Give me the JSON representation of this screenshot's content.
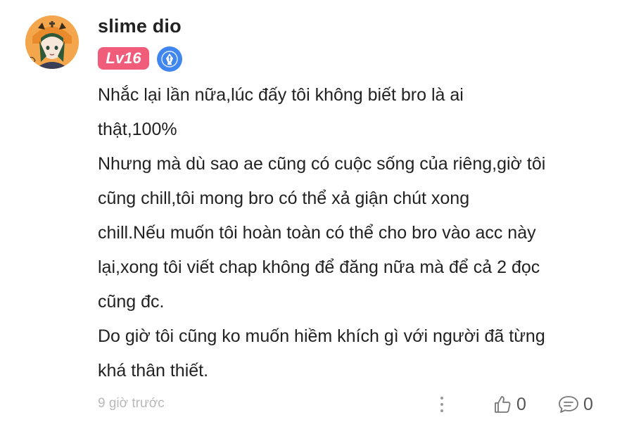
{
  "user": {
    "name": "slime dio",
    "level_badge": "Lv16"
  },
  "comment": {
    "lines": [
      "Nhắc lại lần nữa,lúc đấy tôi không biết bro là ai",
      "thật,100%",
      "Nhưng mà dù sao ae cũng có cuộc sống của riêng,giờ tôi",
      "cũng chill,tôi mong bro có thể xả giận chút xong",
      "chill.Nếu muốn tôi hoàn toàn có thể cho bro vào acc này",
      "lại,xong tôi viết chap không để đăng nữa mà để cả 2 đọc",
      "cũng đc.",
      "Do giờ tôi cũng ko muốn hiềm khích gì với người đã từng",
      "khá thân thiết."
    ]
  },
  "footer": {
    "timestamp": "9 giờ trước",
    "like_count": "0",
    "reply_count": "0"
  },
  "icons": {
    "avatar": "avatar-image",
    "writer_badge": "pen-nib-icon",
    "more": "more-vertical-icon",
    "like": "thumbs-up-icon",
    "reply": "comment-bubble-icon"
  },
  "colors": {
    "level_badge_bg": "#f25c7b",
    "writer_badge_bg": "#3f86f0",
    "timestamp": "#b8b8b8"
  }
}
